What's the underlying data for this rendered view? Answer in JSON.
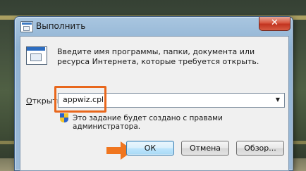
{
  "window": {
    "title": "Выполнить",
    "close_label": "✕"
  },
  "dialog": {
    "description": "Введите имя программы, папки, документа или ресурса Интернета, которые требуется открыть.",
    "open_label_accel": "О",
    "open_label_rest": "ткрыть:",
    "open_value": "appwiz.cpl",
    "dropdown_arrow": "▼",
    "admin_note": "Это задание будет создано с правами администратора."
  },
  "buttons": {
    "ok": "ОК",
    "cancel": "Отмена",
    "browse": "Обзор..."
  },
  "colors": {
    "highlight": "#e8671c",
    "arrow": "#f0761f"
  },
  "icons": {
    "title": "run-window-icon",
    "dialog": "run-program-icon",
    "admin": "uac-shield-icon",
    "dropdown": "chevron-down-icon"
  }
}
